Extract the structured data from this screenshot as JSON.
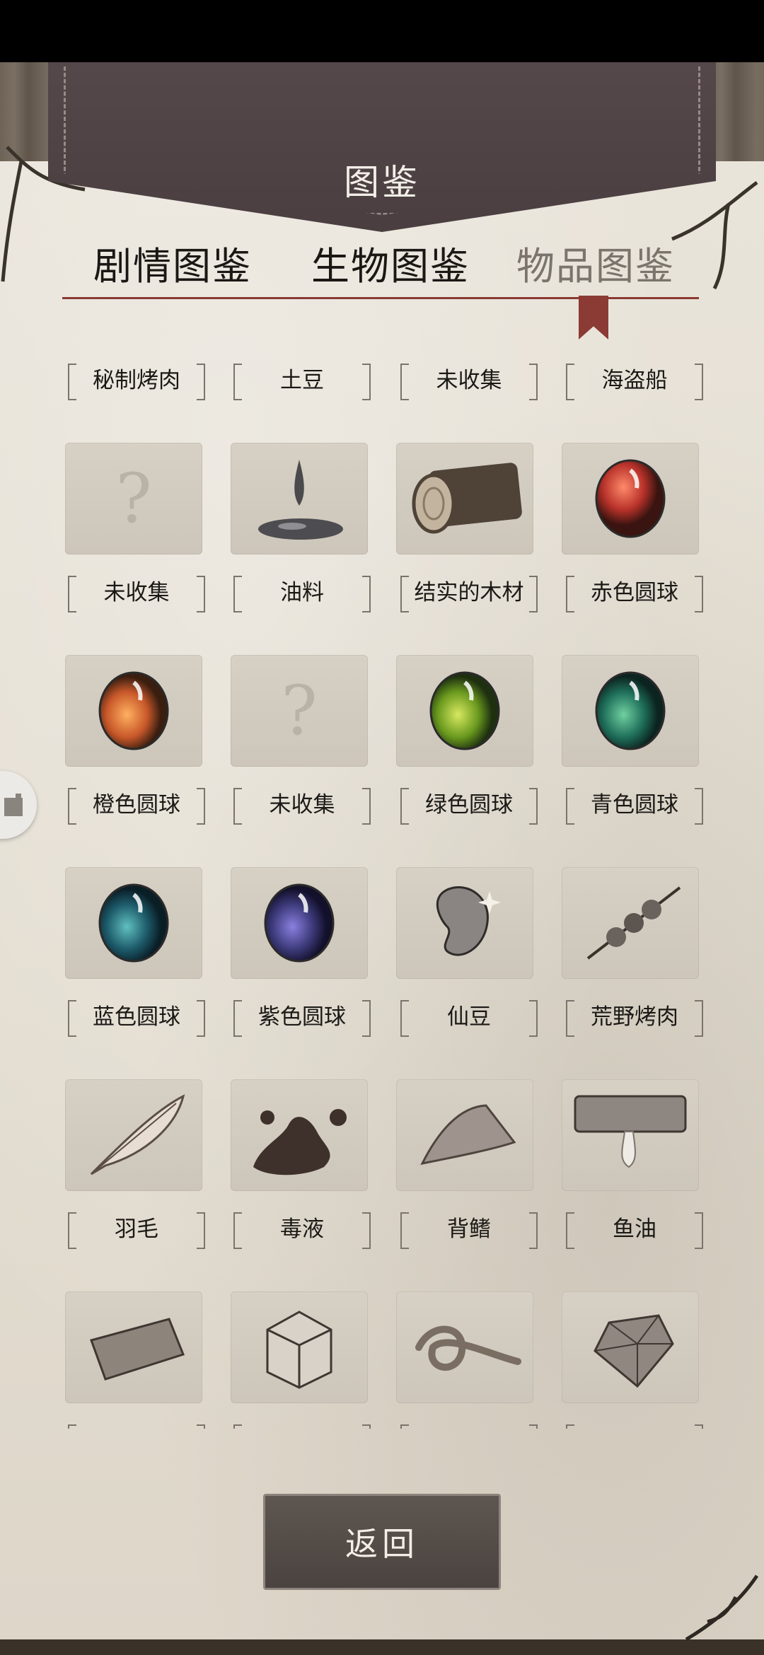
{
  "header": {
    "title": "图鉴"
  },
  "tabs": [
    {
      "label": "剧情图鉴",
      "active": false
    },
    {
      "label": "生物图鉴",
      "active": false
    },
    {
      "label": "物品图鉴",
      "active": true
    }
  ],
  "top_row": [
    "秘制烤肉",
    "土豆",
    "未收集",
    "海盗船"
  ],
  "items": [
    {
      "label": "未收集",
      "icon": "question-mark-icon",
      "collected": false
    },
    {
      "label": "油料",
      "icon": "oil-puddle-icon",
      "collected": true
    },
    {
      "label": "结实的木材",
      "icon": "log-icon",
      "collected": true
    },
    {
      "label": "赤色圆球",
      "icon": "red-orb-icon",
      "color": "#b8322a",
      "collected": true
    },
    {
      "label": "橙色圆球",
      "icon": "orange-orb-icon",
      "color": "#c8582a",
      "collected": true
    },
    {
      "label": "未收集",
      "icon": "question-mark-icon",
      "collected": false
    },
    {
      "label": "绿色圆球",
      "icon": "green-orb-icon",
      "color": "#6a9a1e",
      "collected": true
    },
    {
      "label": "青色圆球",
      "icon": "cyan-orb-icon",
      "color": "#1f6f5a",
      "collected": true
    },
    {
      "label": "蓝色圆球",
      "icon": "blue-orb-icon",
      "color": "#1d5a6a",
      "collected": true
    },
    {
      "label": "紫色圆球",
      "icon": "purple-orb-icon",
      "color": "#3d3a7a",
      "collected": true
    },
    {
      "label": "仙豆",
      "icon": "bean-icon",
      "collected": true
    },
    {
      "label": "荒野烤肉",
      "icon": "meat-skewer-icon",
      "collected": true
    },
    {
      "label": "羽毛",
      "icon": "feather-icon",
      "collected": true
    },
    {
      "label": "毒液",
      "icon": "venom-splash-icon",
      "collected": true
    },
    {
      "label": "背鳍",
      "icon": "dorsal-fin-icon",
      "collected": true
    },
    {
      "label": "鱼油",
      "icon": "fish-oil-icon",
      "collected": true
    },
    {
      "label": "",
      "icon": "stone-slab-icon",
      "collected": true
    },
    {
      "label": "",
      "icon": "crate-icon",
      "collected": true
    },
    {
      "label": "",
      "icon": "rope-icon",
      "collected": true
    },
    {
      "label": "",
      "icon": "crystal-icon",
      "collected": true
    }
  ],
  "footer": {
    "return_label": "返回"
  },
  "colors": {
    "accent": "#8a3a34",
    "header_leather": "#4e4244",
    "paper": "#e6e0d5"
  }
}
